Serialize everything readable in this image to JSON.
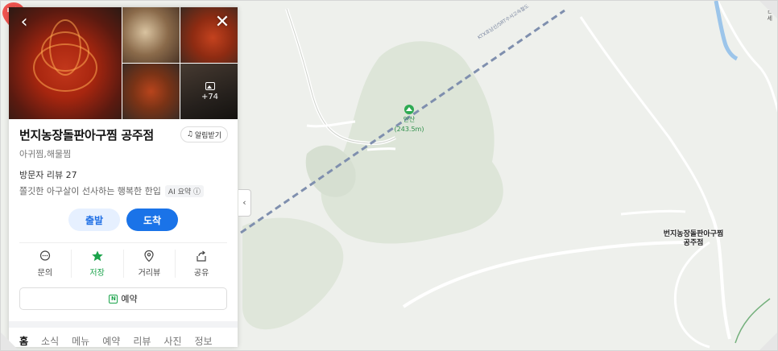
{
  "place": {
    "name": "번지농장돌판아구찜 공주점",
    "category": "아귀찜,해물찜",
    "alarm_label": "알림받기",
    "visitor_reviews": "방문자 리뷰 27",
    "summary": "쫄깃한 아구살이 선사하는 행복한 한입",
    "ai_badge": "AI 요약",
    "photo_more": "+74"
  },
  "route": {
    "depart": "출발",
    "arrive": "도착"
  },
  "actions": [
    {
      "label": "문의",
      "icon": "chat-icon"
    },
    {
      "label": "저장",
      "icon": "star-icon"
    },
    {
      "label": "거리뷰",
      "icon": "location-pin-icon"
    },
    {
      "label": "공유",
      "icon": "share-icon"
    }
  ],
  "booking_label": "예약",
  "tabs": [
    "홈",
    "소식",
    "메뉴",
    "예약",
    "리뷰",
    "사진",
    "정보"
  ],
  "active_tab": "홈",
  "map": {
    "peak_name": "안산",
    "peak_elevation": "(243.5m)",
    "rail_label": "KTX호남선/SRT수서고속철도",
    "marker_name_line1": "번지농장돌판아구찜",
    "marker_name_line2": "공주점",
    "edge_label": "ㄷ\n세"
  },
  "colors": {
    "accent": "#1a73e8",
    "saved": "#1aa34a",
    "marker": "#f0544f",
    "map_bg": "#eef0ec",
    "forest": "#dde5d8"
  }
}
